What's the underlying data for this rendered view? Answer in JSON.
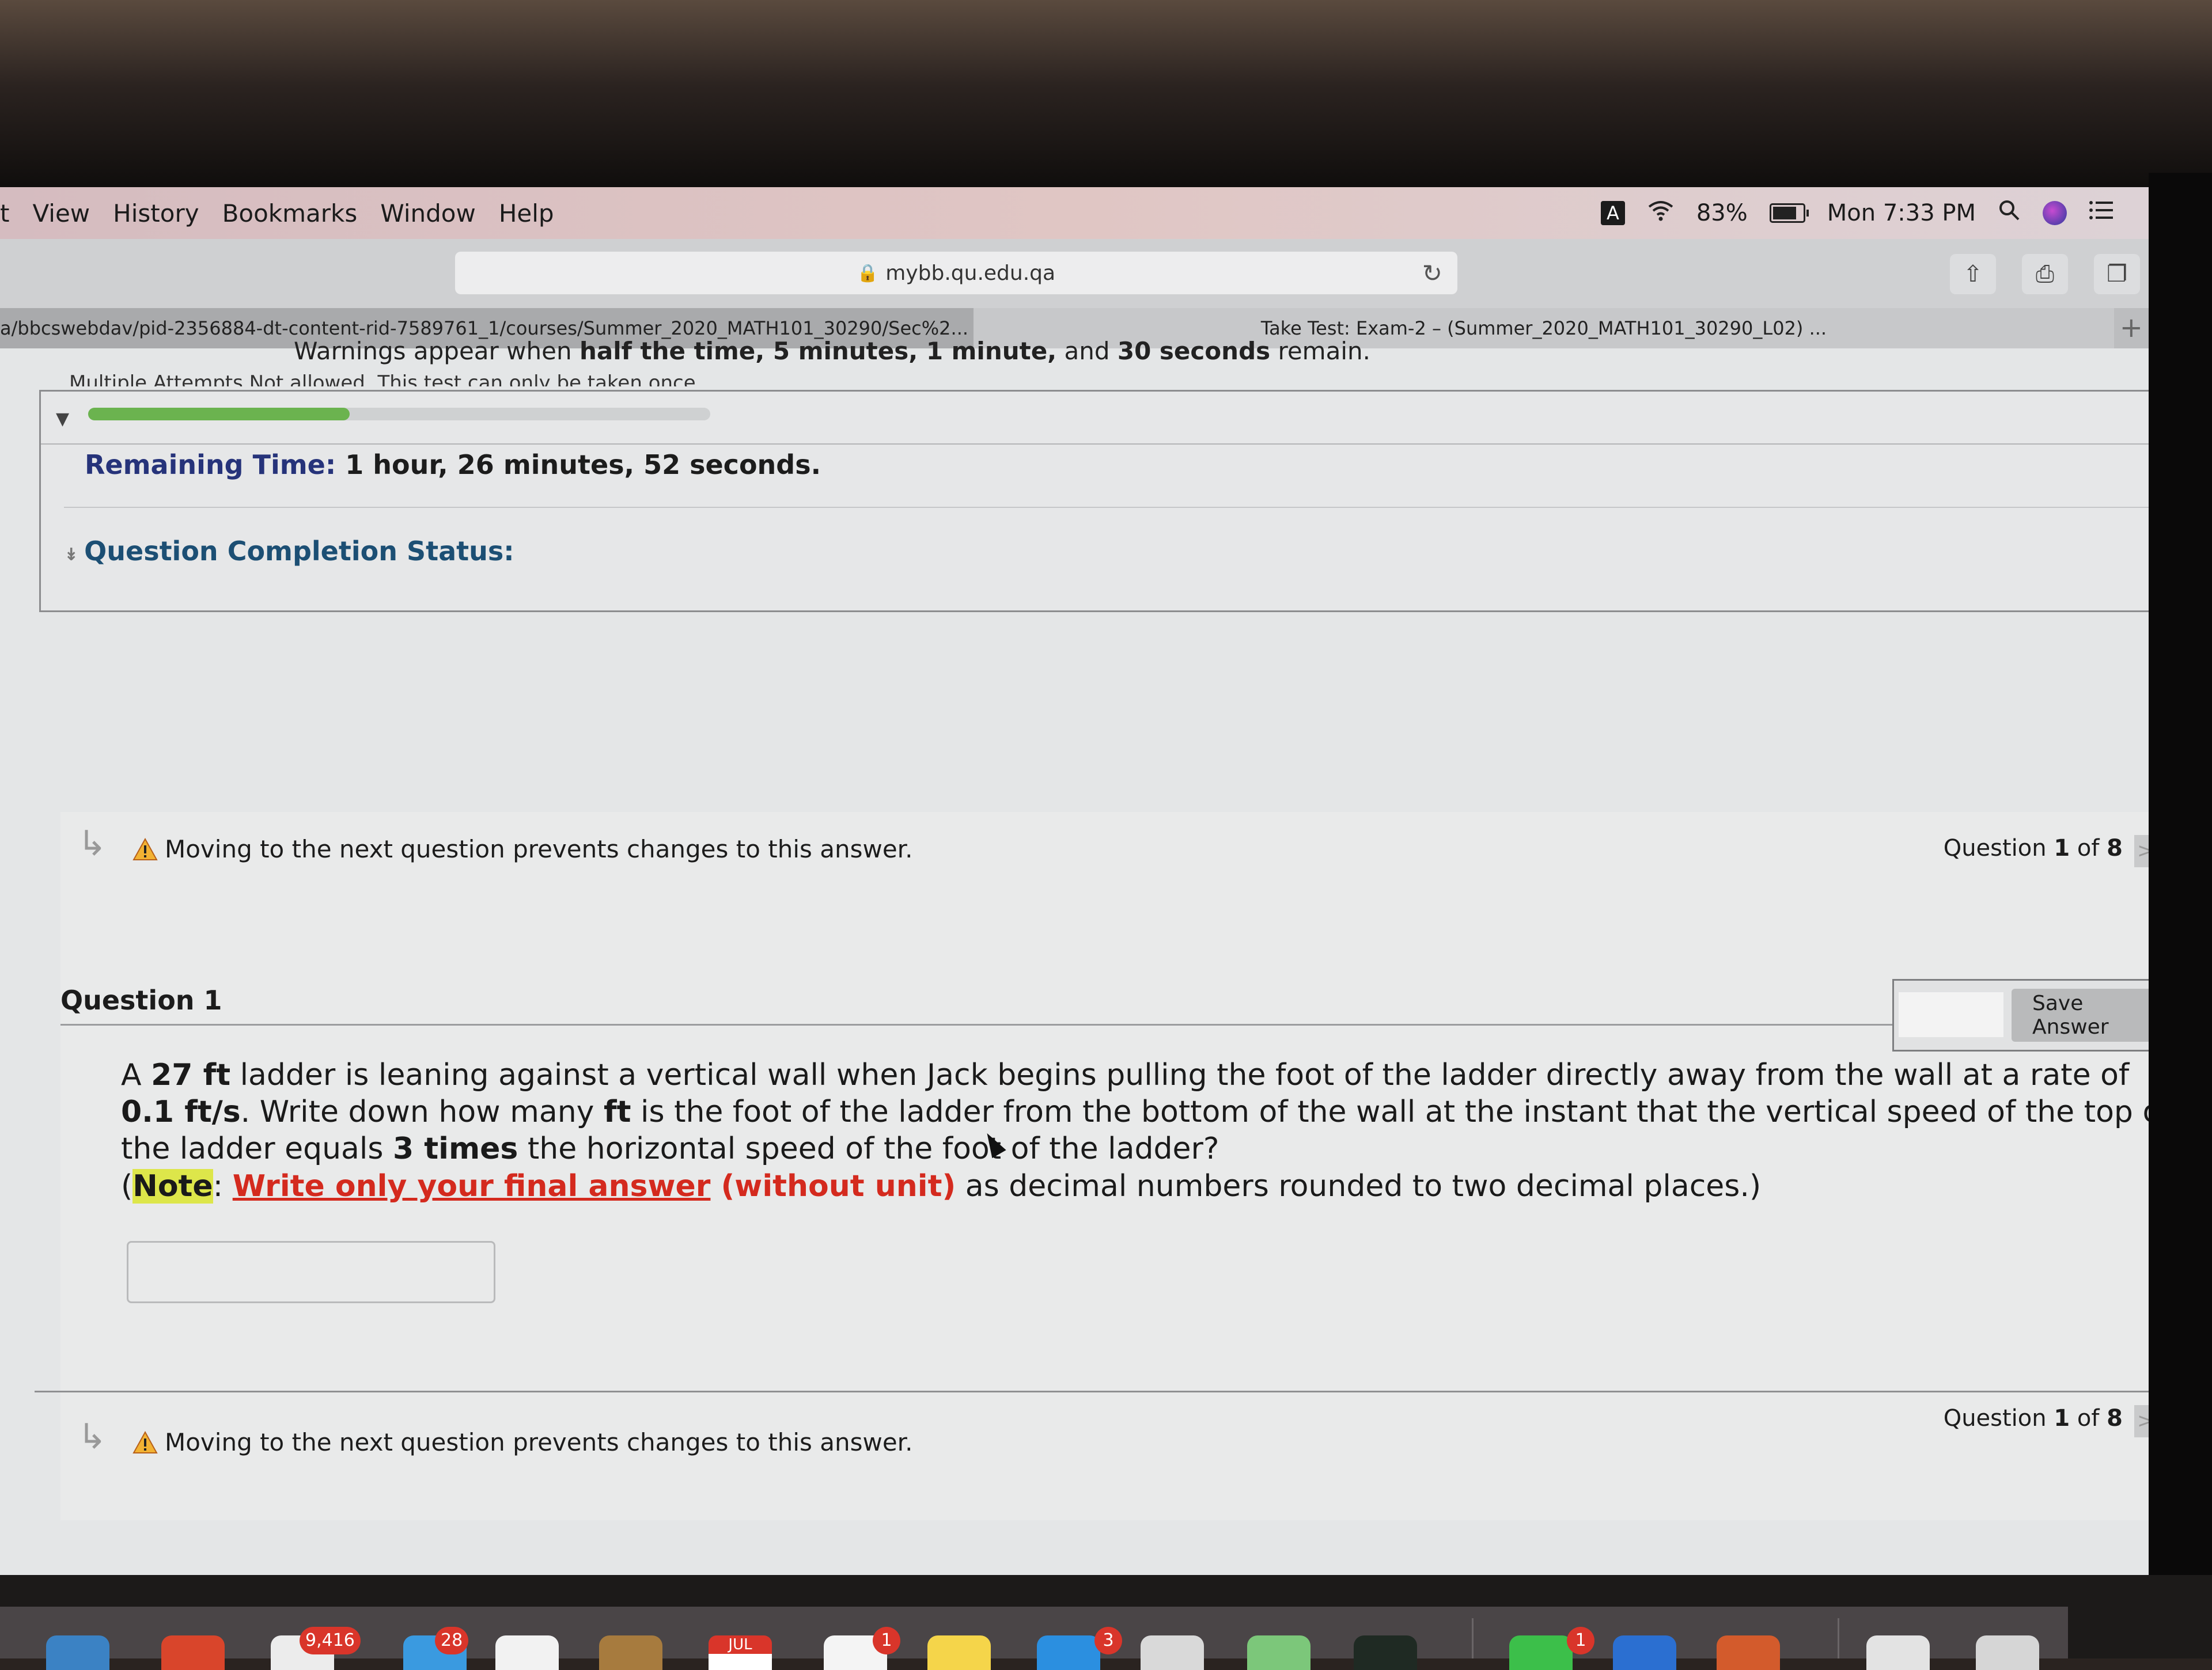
{
  "menubar": {
    "items": [
      "t",
      "View",
      "History",
      "Bookmarks",
      "Window",
      "Help"
    ],
    "status": {
      "input_source": "A",
      "battery_percent": "83%",
      "battery_level": 0.83,
      "clock": "Mon 7:33 PM"
    }
  },
  "browser": {
    "url": "mybb.qu.edu.qa",
    "tabs": [
      {
        "title": "a/bbcswebdav/pid-2356884-dt-content-rid-7589761_1/courses/Summer_2020_MATH101_30290/Sec%2...",
        "active": false
      },
      {
        "title": "Take Test: Exam-2 – (Summer_2020_MATH101_30290_L02) ...",
        "active": true
      }
    ],
    "new_tab_label": "+"
  },
  "test": {
    "warning_prefix": "Warnings appear when ",
    "warning_bold": "half the time, 5 minutes, 1 minute,",
    "warning_and": " and ",
    "warning_bold2": "30 seconds",
    "warning_suffix": " remain.",
    "multiple_attempts": "Multiple Attempts  Not allowed. This test can only be taken once.",
    "timer_progress": 0.42,
    "remaining_label": "Remaining Time:",
    "remaining_value": "1 hour, 26 minutes, 52 seconds.",
    "completion_status_label": "Question Completion Status:"
  },
  "question_nav": {
    "warning": "Moving to the next question prevents changes to this answer.",
    "counter_prefix": "Question ",
    "current": "1",
    "of": " of ",
    "total": "8",
    "next_label": ">"
  },
  "question": {
    "title": "Question 1",
    "save_label": "Save Answer",
    "text_parts": {
      "p1": "A ",
      "b1": "27 ft",
      "p2": "  ladder is leaning against a vertical wall when Jack begins pulling the foot of the ladder directly away from the wall at a rate of ",
      "b2": "0.1 ft/s",
      "p3": ". Write down how many ",
      "b3": "ft",
      "p4": " is the foot of the ladder from the bottom of the wall at the instant that the vertical speed of the top of the ladder equals ",
      "b4": "3 times",
      "p5": " the horizontal speed of the foot of the ladder?"
    },
    "note": {
      "open": "(",
      "label": "Note",
      "colon": ": ",
      "red_underlined": "Write only your final answer",
      "red": " (without unit)",
      "rest": " as decimal numbers rounded to two decimal places.)"
    },
    "answer_value": ""
  },
  "dock": {
    "badges": [
      "9,416",
      "28",
      "1",
      "3",
      "1"
    ],
    "calendar_month": "JUL"
  }
}
